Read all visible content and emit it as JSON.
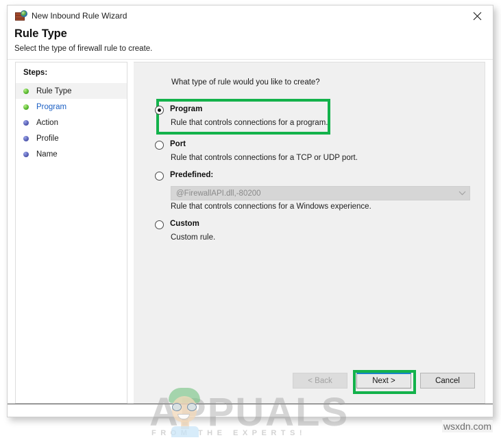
{
  "window": {
    "title": "New Inbound Rule Wizard",
    "icon": "firewall-icon",
    "close_label": "close-icon"
  },
  "header": {
    "title": "Rule Type",
    "subtitle": "Select the type of firewall rule to create."
  },
  "sidebar": {
    "heading": "Steps:",
    "items": [
      {
        "label": "Rule Type",
        "state": "current",
        "bullet": "green"
      },
      {
        "label": "Program",
        "state": "link",
        "bullet": "green"
      },
      {
        "label": "Action",
        "state": "pending",
        "bullet": "blue"
      },
      {
        "label": "Profile",
        "state": "pending",
        "bullet": "blue"
      },
      {
        "label": "Name",
        "state": "pending",
        "bullet": "blue"
      }
    ]
  },
  "main": {
    "question": "What type of rule would you like to create?",
    "options": [
      {
        "id": "program",
        "title": "Program",
        "description": "Rule that controls connections for a program.",
        "selected": true,
        "highlighted": true
      },
      {
        "id": "port",
        "title": "Port",
        "description": "Rule that controls connections for a TCP or UDP port.",
        "selected": false,
        "highlighted": false
      },
      {
        "id": "predefined",
        "title": "Predefined:",
        "description": "Rule that controls connections for a Windows experience.",
        "selected": false,
        "highlighted": false,
        "dropdown": {
          "value": "@FirewallAPI.dll,-80200",
          "enabled": false,
          "chevron": "chevron-down-icon"
        }
      },
      {
        "id": "custom",
        "title": "Custom",
        "description": "Custom rule.",
        "selected": false,
        "highlighted": false
      }
    ]
  },
  "footer": {
    "back_label": "< Back",
    "back_disabled": true,
    "next_label": "Next >",
    "next_default": true,
    "next_highlighted": true,
    "cancel_label": "Cancel"
  },
  "annotations": {
    "highlight_color": "#13b24b"
  },
  "watermark": {
    "brand": "APPUALS",
    "tagline": "FROM THE EXPERTS!",
    "source": "wsxdn.com"
  }
}
